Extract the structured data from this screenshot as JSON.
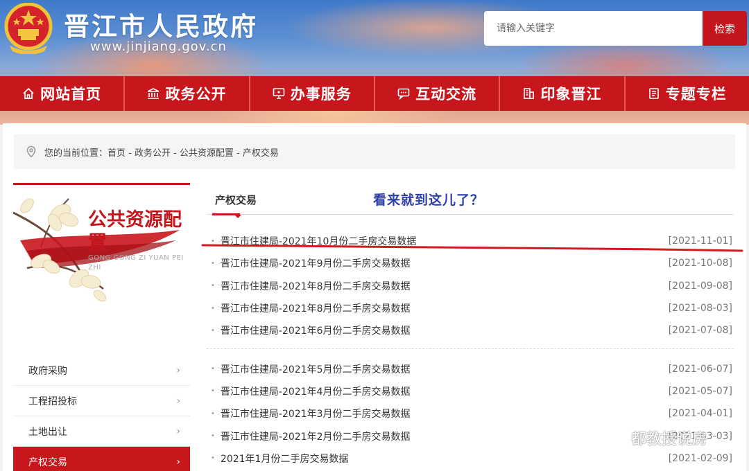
{
  "header": {
    "site_title": "晋江市人民政府",
    "site_url": "www.jinjiang.gov.cn",
    "search_placeholder": "请输入关键字",
    "search_button": "检索"
  },
  "nav": {
    "items": [
      {
        "label": "网站首页",
        "icon": "home-icon"
      },
      {
        "label": "政务公开",
        "icon": "bank-icon"
      },
      {
        "label": "办事服务",
        "icon": "monitor-icon"
      },
      {
        "label": "互动交流",
        "icon": "chat-icon"
      },
      {
        "label": "印象晋江",
        "icon": "building-icon"
      },
      {
        "label": "专题专栏",
        "icon": "document-icon"
      }
    ]
  },
  "breadcrumb": {
    "text": "您的当前位置：首页 - 政务公开 - 公共资源配置 - 产权交易"
  },
  "sidebar": {
    "banner_title": "公共资源配置",
    "banner_pinyin": "GONG GONG ZI YUAN PEI ZHI",
    "items": [
      {
        "label": "政府采购",
        "active": false
      },
      {
        "label": "工程招投标",
        "active": false
      },
      {
        "label": "土地出让",
        "active": false
      },
      {
        "label": "产权交易",
        "active": true
      }
    ]
  },
  "main": {
    "tab_label": "产权交易",
    "annotation": "看来就到这儿了？",
    "group1": [
      {
        "title": "晋江市住建局-2021年10月份二手房交易数据",
        "date": "[2021-11-01]"
      },
      {
        "title": "晋江市住建局-2021年9月份二手房交易数据",
        "date": "[2021-10-08]"
      },
      {
        "title": "晋江市住建局-2021年8月份二手房交易数据",
        "date": "[2021-09-08]"
      },
      {
        "title": "晋江市住建局-2021年8月份二手房交易数据",
        "date": "[2021-08-03]"
      },
      {
        "title": "晋江市住建局-2021年6月份二手房交易数据",
        "date": "[2021-07-08]"
      }
    ],
    "group2": [
      {
        "title": "晋江市住建局-2021年5月份二手房交易数据",
        "date": "[2021-06-07]"
      },
      {
        "title": "晋江市住建局-2021年4月份二手房交易数据",
        "date": "[2021-05-07]"
      },
      {
        "title": "晋江市住建局-2021年3月份二手房交易数据",
        "date": "[2021-04-01]"
      },
      {
        "title": "晋江市住建局-2021年2月份二手房交易数据",
        "date": "[2021-03-03]"
      },
      {
        "title": "2021年1月份二手房交易数据",
        "date": "[2021-02-09]"
      }
    ]
  },
  "watermark": {
    "text": "都教授说房"
  },
  "colors": {
    "brand_red": "#c8161d",
    "annotation_blue": "#2d3fa8"
  }
}
